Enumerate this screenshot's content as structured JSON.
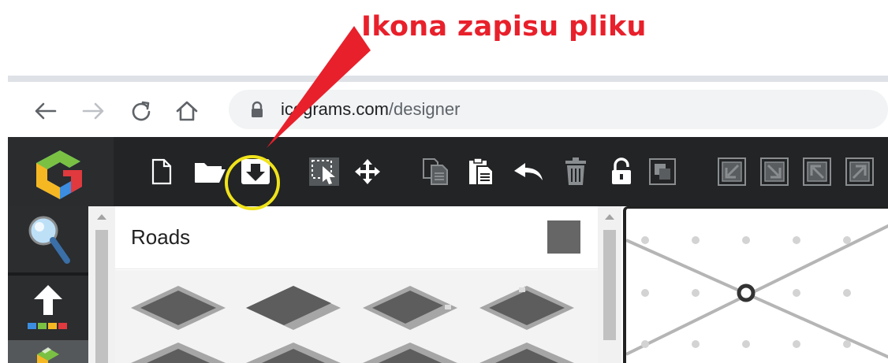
{
  "annotation": {
    "text": "Ikona zapisu pliku",
    "color": "#e8202b",
    "highlight_color": "#f0e31a"
  },
  "browser": {
    "url_host": "icograms.com",
    "url_path": "/designer",
    "icons": [
      "back-arrow-icon",
      "forward-arrow-icon",
      "reload-icon",
      "home-icon",
      "lock-icon"
    ]
  },
  "toolbar": {
    "icons": [
      "new-file-icon",
      "open-folder-icon",
      "save-file-icon",
      "select-icon",
      "move-icon",
      "copy-icon",
      "paste-icon",
      "undo-icon",
      "delete-icon",
      "lock-icon",
      "group-icon",
      "send-backward-icon",
      "send-to-back-icon",
      "bring-forward-icon",
      "bring-to-front-icon"
    ]
  },
  "left_strip": {
    "icons": [
      "search-icon",
      "upload-icon",
      "shapes-icon"
    ]
  },
  "panel": {
    "title": "Roads",
    "swatch_color": "#666666"
  }
}
